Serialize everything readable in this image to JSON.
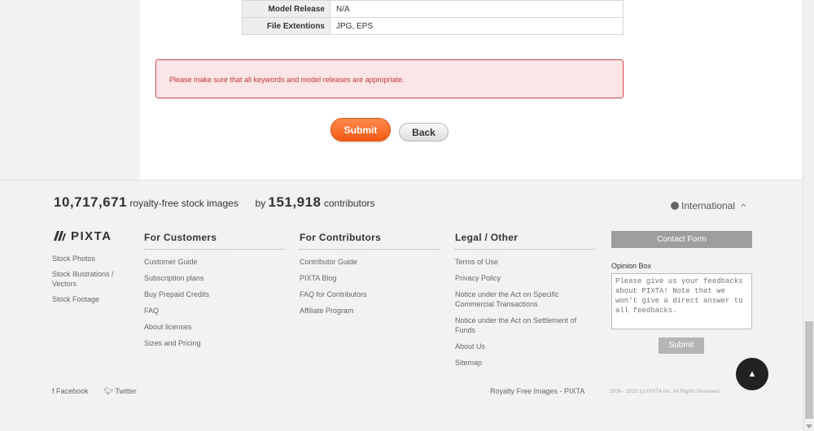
{
  "details_table": [
    {
      "key": "Model Release",
      "value": "N/A"
    },
    {
      "key": "File Extentions",
      "value": "JPG, EPS"
    }
  ],
  "alert": {
    "message": "Please make sure that all keywords and model releases are appropriate."
  },
  "actions": {
    "submit_label": "Submit",
    "back_label": "Back"
  },
  "footer": {
    "stats": {
      "image_count": "10,717,671",
      "images_text": "royalty-free stock images",
      "by_text": "by",
      "contributor_count": "151,918",
      "contributors_text": "contributors"
    },
    "international_label": "International",
    "logo_text": "PIXTA",
    "left_links": [
      "Stock Photos",
      "Stock Illustrations / Vectors",
      "Stock Footage"
    ],
    "columns": [
      {
        "title": "For Customers",
        "items": [
          "Customer Guide",
          "Subscription plans",
          "Buy Prepaid Credits",
          "FAQ",
          "About licenses",
          "Sizes and Pricing"
        ]
      },
      {
        "title": "For Contributors",
        "items": [
          "Contributor Guide",
          "PIXTA Blog",
          "FAQ for Contributors",
          "Affiliate Program"
        ]
      },
      {
        "title": "Legal / Other",
        "items": [
          "Terms of Use",
          "Privacy Policy",
          "Notice under the Act on Specific Commercial Transactions",
          "Notice under the Act on Settlement of Funds",
          "About Us",
          "Sitemap"
        ]
      }
    ],
    "contact_form_label": "Contact Form",
    "opinion_box": {
      "label": "Opinion Box",
      "placeholder": "Please give us your feedbacks about PIXTA! Note that we won't give a direct answer to all feedbacks.",
      "submit_label": "Submit"
    },
    "social": {
      "facebook": "Facebook",
      "twitter": "Twitter"
    },
    "royalty_text": "Royalty Free Images - PIXTA",
    "copyright": "2006 - 2015 (c) PIXTA Inc. All Rights Reserved."
  }
}
